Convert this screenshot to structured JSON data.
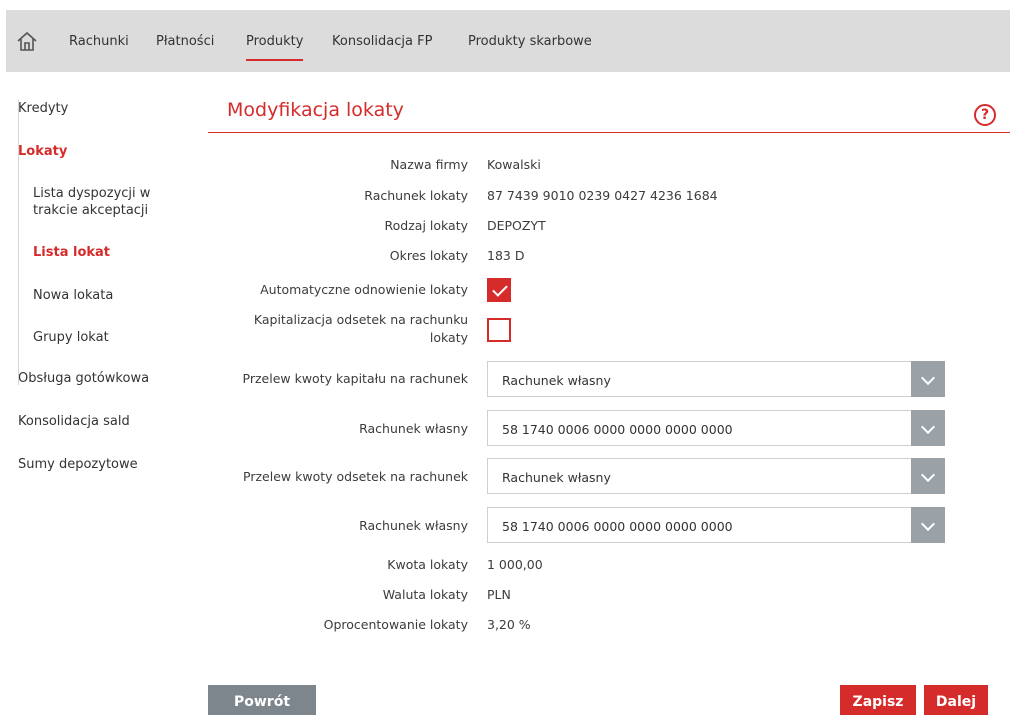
{
  "nav": {
    "items": [
      {
        "label": "Rachunki"
      },
      {
        "label": "Płatności"
      },
      {
        "label": "Produkty"
      },
      {
        "label": "Konsolidacja FP"
      },
      {
        "label": "Produkty skarbowe"
      }
    ]
  },
  "sidebar": {
    "kredyty": "Kredyty",
    "lokaty": "Lokaty",
    "sub": {
      "lista_dyspozycji": "Lista dyspozycji w trakcie akceptacji",
      "lista_lokat": "Lista lokat",
      "nowa_lokata": "Nowa lokata",
      "grupy_lokat": "Grupy lokat"
    },
    "obsluga": "Obsługa gotówkowa",
    "konsolidacja_sald": "Konsolidacja sald",
    "sumy": "Sumy depozytowe"
  },
  "page": {
    "title": "Modyfikacja lokaty",
    "help": "?"
  },
  "form": {
    "nazwa_firmy_label": "Nazwa firmy",
    "nazwa_firmy": "Kowalski",
    "rachunek_lokaty_label": "Rachunek lokaty",
    "rachunek_lokaty": "87 7439 9010 0239 0427 4236 1684",
    "rodzaj_label": "Rodzaj lokaty",
    "rodzaj": "DEPOZYT",
    "okres_label": "Okres lokaty",
    "okres": "183 D",
    "auto_label": "Automatyczne odnowienie lokaty",
    "auto_checked": true,
    "kapitalizacja_label_1": "Kapitalizacja odsetek na rachunku",
    "kapitalizacja_label_2": "lokaty",
    "kapitalizacja_checked": false,
    "przelew_kapitalu_label": "Przelew kwoty kapitału na rachunek",
    "przelew_kapitalu": "Rachunek własny",
    "rachunek_wlasny_1_label": "Rachunek własny",
    "rachunek_wlasny_1": "58 1740 0006 0000 0000 0000 0000",
    "przelew_odsetek_label": "Przelew kwoty odsetek na rachunek",
    "przelew_odsetek": "Rachunek własny",
    "rachunek_wlasny_2_label": "Rachunek własny",
    "rachunek_wlasny_2": "58 1740 0006 0000 0000 0000 0000",
    "kwota_label": "Kwota lokaty",
    "kwota": "1 000,00",
    "waluta_label": "Waluta lokaty",
    "waluta": "PLN",
    "oprocentowanie_label": "Oprocentowanie lokaty",
    "oprocentowanie": "3,20 %"
  },
  "buttons": {
    "back": "Powrót",
    "save": "Zapisz",
    "next": "Dalej"
  },
  "colors": {
    "accent": "#d62b2b",
    "topbar": "#dcdcdc",
    "button_gray": "#7d868d"
  }
}
